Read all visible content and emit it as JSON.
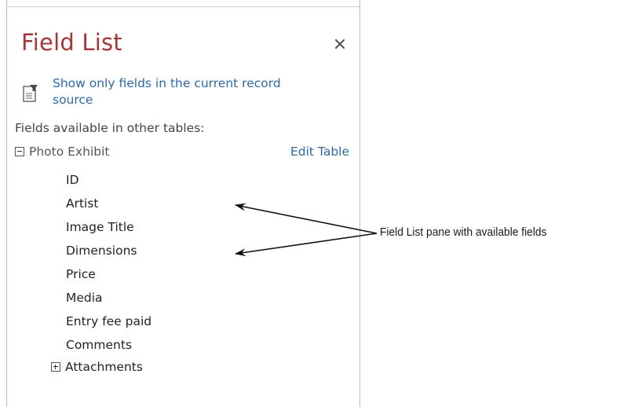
{
  "pane": {
    "title": "Field List",
    "close_icon": "close-icon",
    "show_only_label": "Show only fields in the current record source",
    "filter_icon": "filter-list-icon",
    "section_label": "Fields available in other tables:",
    "table": {
      "name": "Photo Exhibit",
      "expanded": true,
      "edit_label": "Edit Table",
      "fields": [
        "ID",
        "Artist",
        "Image Title",
        "Dimensions",
        "Price",
        "Media",
        "Entry fee paid",
        "Comments"
      ],
      "attachments_label": "Attachments"
    }
  },
  "callout": {
    "text": "Field List pane with available fields"
  },
  "colors": {
    "title": "#a4373a",
    "link": "#2e6aa6",
    "border": "#b9b9b9"
  }
}
